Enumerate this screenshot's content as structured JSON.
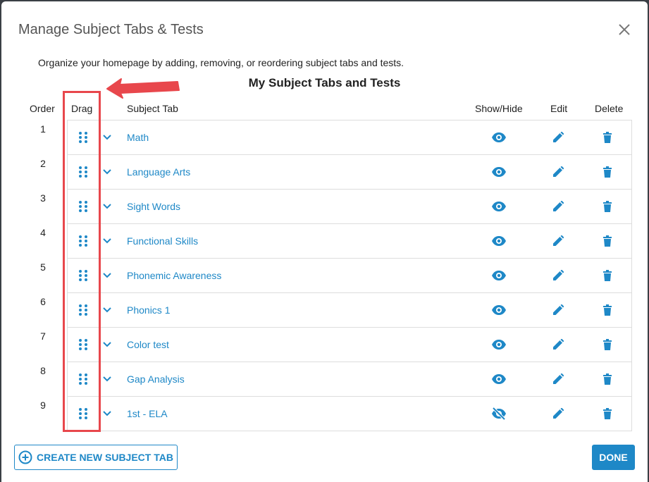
{
  "dialog": {
    "title": "Manage Subject Tabs & Tests",
    "description": "Organize your homepage by adding, removing, or reordering subject tabs and tests.",
    "section_title": "My Subject Tabs and Tests"
  },
  "headers": {
    "order": "Order",
    "drag": "Drag",
    "subject_tab": "Subject Tab",
    "show_hide": "Show/Hide",
    "edit": "Edit",
    "delete": "Delete"
  },
  "rows": [
    {
      "order": "1",
      "name": "Math",
      "visible": true
    },
    {
      "order": "2",
      "name": "Language Arts",
      "visible": true
    },
    {
      "order": "3",
      "name": "Sight Words",
      "visible": true
    },
    {
      "order": "4",
      "name": "Functional Skills",
      "visible": true
    },
    {
      "order": "5",
      "name": "Phonemic Awareness",
      "visible": true
    },
    {
      "order": "6",
      "name": "Phonics 1",
      "visible": true
    },
    {
      "order": "7",
      "name": "Color test",
      "visible": true
    },
    {
      "order": "8",
      "name": "Gap Analysis",
      "visible": true
    },
    {
      "order": "9",
      "name": "1st - ELA",
      "visible": false
    }
  ],
  "buttons": {
    "create": "CREATE NEW SUBJECT TAB",
    "done": "DONE"
  },
  "icons": {
    "close": "close-icon",
    "drag": "drag-handle-icon",
    "expand": "chevron-down-icon",
    "visible": "eye-icon",
    "hidden": "eye-off-icon",
    "edit": "pencil-icon",
    "delete": "trash-icon",
    "add": "plus-circle-icon"
  },
  "colors": {
    "accent": "#1e88c7",
    "highlight": "#e8474c",
    "border": "#dddddd"
  }
}
